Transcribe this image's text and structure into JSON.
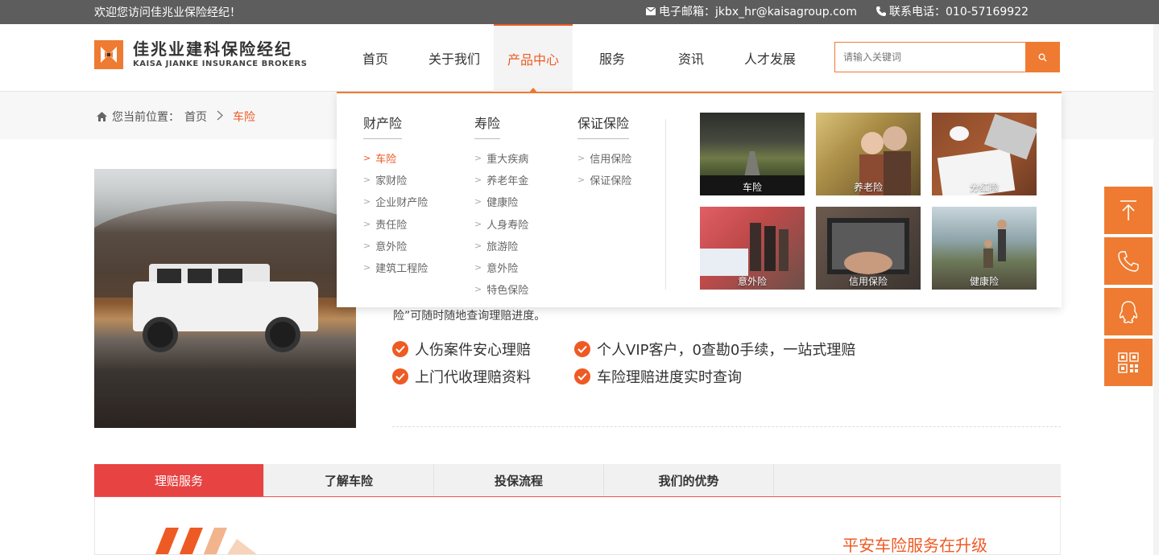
{
  "topbar": {
    "welcome": "欢迎您访问佳兆业保险经纪！",
    "email": "电子邮箱：jkbx_hr@kaisagroup.com",
    "phone": "联系电话：010-57169922"
  },
  "logo": {
    "cn": "佳兆业建科保险经纪",
    "en": "KAISA JIANKE INSURANCE BROKERS"
  },
  "nav": {
    "items": [
      "首页",
      "关于我们",
      "产品中心",
      "服务",
      "资讯",
      "人才发展"
    ],
    "active_index": 2
  },
  "search": {
    "placeholder": "请输入关键词"
  },
  "breadcrumb": {
    "label": "您当前位置：",
    "home": "首页",
    "current": "车险"
  },
  "mega": {
    "columns": [
      {
        "title": "财产险",
        "items": [
          "车险",
          "家财险",
          "企业财产险",
          "责任险",
          "意外险",
          "建筑工程险"
        ]
      },
      {
        "title": "寿险",
        "items": [
          "重大疾病",
          "养老年金",
          "健康险",
          "人身寿险",
          "旅游险",
          "意外险",
          "特色保险"
        ]
      },
      {
        "title": "保证保险",
        "items": [
          "信用保险",
          "保证保险"
        ]
      }
    ],
    "thumbs": [
      "车险",
      "养老险",
      "分红险",
      "意外险",
      "信用保险",
      "健康险"
    ]
  },
  "intro": {
    "line": "险”可随时随地查询理赔进度。",
    "features": [
      "人伤案件安心理赔",
      "个人VIP客户，0查勘0手续，一站式理赔",
      "上门代收理赔资料",
      "车险理赔进度实时查询"
    ]
  },
  "tabs": [
    "理赔服务",
    "了解车险",
    "投保流程",
    "我们的优势"
  ],
  "panel": {
    "title": "平安车险服务在升级"
  },
  "colors": {
    "accent": "#ee7b31",
    "accent_dark": "#ee5a24",
    "tab_active": "#e84343"
  },
  "floats": [
    "back-to-top-icon",
    "phone-icon",
    "qq-icon",
    "qrcode-icon"
  ]
}
